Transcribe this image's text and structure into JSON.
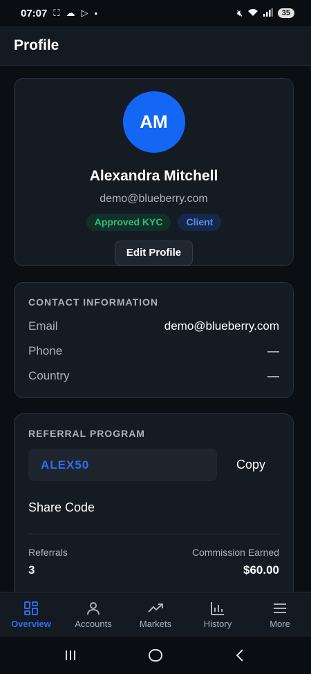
{
  "status_bar": {
    "time": "07:07",
    "battery": "35"
  },
  "header": {
    "title": "Profile"
  },
  "profile": {
    "initials": "AM",
    "name": "Alexandra Mitchell",
    "email": "demo@blueberry.com",
    "badges": [
      "Approved KYC",
      "Client"
    ],
    "edit_label": "Edit Profile"
  },
  "contact": {
    "title": "CONTACT INFORMATION",
    "rows": [
      {
        "label": "Email",
        "value": "demo@blueberry.com"
      },
      {
        "label": "Phone",
        "value": "—"
      },
      {
        "label": "Country",
        "value": "—"
      }
    ]
  },
  "referral": {
    "title": "REFERRAL PROGRAM",
    "code": "ALEX50",
    "copy_label": "Copy",
    "share_label": "Share Code",
    "referrals_label": "Referrals",
    "referrals_value": "3",
    "commission_label": "Commission Earned",
    "commission_value": "$60.00"
  },
  "nav": {
    "items": [
      {
        "label": "Overview",
        "icon": "grid-icon",
        "active": true
      },
      {
        "label": "Accounts",
        "icon": "user-icon",
        "active": false
      },
      {
        "label": "Markets",
        "icon": "trending-icon",
        "active": false
      },
      {
        "label": "History",
        "icon": "bar-chart-icon",
        "active": false
      },
      {
        "label": "More",
        "icon": "menu-icon",
        "active": false
      }
    ]
  },
  "colors": {
    "accent": "#2f6df0",
    "avatar": "#1467f5",
    "kyc": "#2fbf7a",
    "background": "#0b0f14",
    "card": "#151b23"
  }
}
